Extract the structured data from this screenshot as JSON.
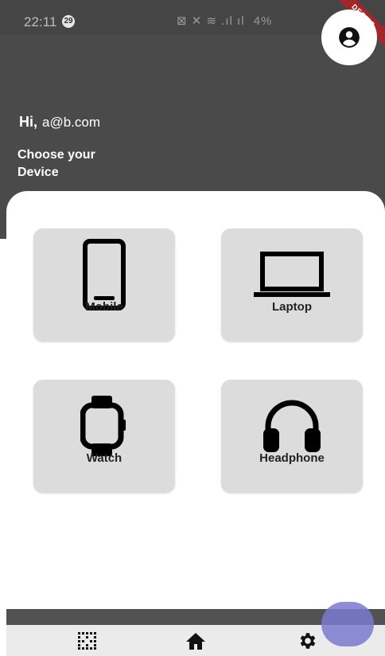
{
  "status_bar": {
    "time": "22:11",
    "notification_count": "29",
    "icons": "⊠ ✕ ≋ .ıl ıl",
    "battery": "4%",
    "debug_banner": "DEBUG"
  },
  "header": {
    "greeting": "Hi,",
    "email": "a@b.com",
    "subtitle": "Choose your Device"
  },
  "devices": [
    {
      "label": "Mobile",
      "icon": "mobile-icon"
    },
    {
      "label": "Laptop",
      "icon": "laptop-icon"
    },
    {
      "label": "Watch",
      "icon": "watch-icon"
    },
    {
      "label": "Headphone",
      "icon": "headphone-icon"
    }
  ],
  "nav": [
    {
      "icon": "grid-icon"
    },
    {
      "icon": "home-icon"
    },
    {
      "icon": "settings-icon"
    }
  ],
  "colors": {
    "header_bg": "#4a4a4a",
    "card_bg": "#dcdcdc",
    "fab": "#7a7acf",
    "debug": "#a3262a"
  }
}
